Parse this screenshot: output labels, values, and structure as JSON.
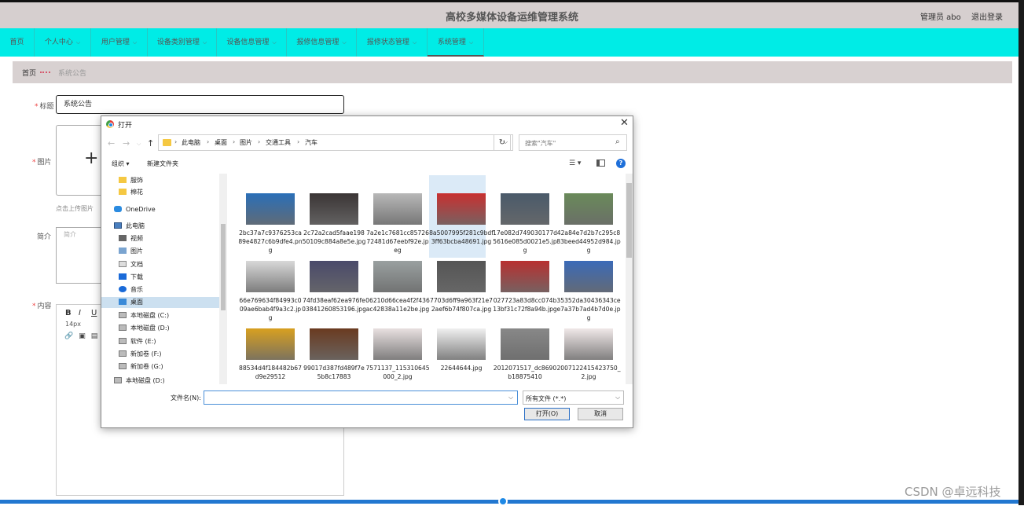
{
  "app": {
    "title": "高校多媒体设备运维管理系统",
    "admin_label": "管理员 abo",
    "logout": "退出登录"
  },
  "nav": [
    {
      "label": "首页",
      "dropdown": false
    },
    {
      "label": "个人中心",
      "dropdown": true
    },
    {
      "label": "用户管理",
      "dropdown": true
    },
    {
      "label": "设备类别管理",
      "dropdown": true
    },
    {
      "label": "设备信息管理",
      "dropdown": true
    },
    {
      "label": "报修信息管理",
      "dropdown": true
    },
    {
      "label": "报修状态管理",
      "dropdown": true
    },
    {
      "label": "系统管理",
      "dropdown": true,
      "active": true
    }
  ],
  "breadcrumb": {
    "home": "首页",
    "current": "系统公告"
  },
  "form": {
    "title_label": "标题",
    "title_value": "系统公告",
    "image_label": "图片",
    "upload_plus": "+",
    "upload_hint": "点击上传图片",
    "intro_label": "简介",
    "intro_placeholder": "简介",
    "content_label": "内容",
    "editor": {
      "bold": "B",
      "italic": "I",
      "underline": "U",
      "font_size": "14px"
    }
  },
  "dialog": {
    "title": "打开",
    "close": "✕",
    "path": [
      "此电脑",
      "桌面",
      "图片",
      "交通工具",
      "汽车"
    ],
    "search_placeholder": "搜索\"汽车\"",
    "organize": "组织 ▾",
    "new_folder": "新建文件夹",
    "sidebar": [
      {
        "label": "服饰",
        "icon": "folder",
        "indent": 1
      },
      {
        "label": "棉花",
        "icon": "folder",
        "indent": 1
      },
      {
        "label": "OneDrive",
        "icon": "cloud",
        "indent": 0
      },
      {
        "label": "此电脑",
        "icon": "pc",
        "indent": 0
      },
      {
        "label": "视频",
        "icon": "video",
        "indent": 1
      },
      {
        "label": "图片",
        "icon": "pic",
        "indent": 1
      },
      {
        "label": "文档",
        "icon": "doc",
        "indent": 1
      },
      {
        "label": "下载",
        "icon": "down",
        "indent": 1
      },
      {
        "label": "音乐",
        "icon": "music",
        "indent": 1
      },
      {
        "label": "桌面",
        "icon": "desk",
        "indent": 1,
        "selected": true
      },
      {
        "label": "本地磁盘 (C:)",
        "icon": "drive",
        "indent": 1
      },
      {
        "label": "本地磁盘 (D:)",
        "icon": "drive",
        "indent": 1
      },
      {
        "label": "软件 (E:)",
        "icon": "drive",
        "indent": 1
      },
      {
        "label": "新加卷 (F:)",
        "icon": "drive",
        "indent": 1
      },
      {
        "label": "新加卷 (G:)",
        "icon": "drive",
        "indent": 1
      },
      {
        "label": "本地磁盘 (D:)",
        "icon": "drive",
        "indent": 0
      }
    ],
    "files": [
      {
        "name": "2bc37a7c9376253ca89e4827c6b9dfe4.png",
        "color": "#2a6fb8"
      },
      {
        "name": "2c72a2cad5faae19850109c884a8e5e.jpg",
        "color": "#3a3535"
      },
      {
        "name": "7a2e1c7681cc8572672481d67eebf92e.jpeg",
        "color": "#b8b8b8"
      },
      {
        "name": "8a5007995f281c9bdf3ff63bcba48691.jpg",
        "color": "#c83030",
        "selected": true
      },
      {
        "name": "17e082d749030177d5616e085d0021e5.jpg",
        "color": "#4a5a6a"
      },
      {
        "name": "42a84e7d2b7c295c883beed44952d984.jpg",
        "color": "#6a8a5a"
      },
      {
        "name": "66e769634f84993c009ae6bab4f9a3c2.jpg",
        "color": "#d8d8d8"
      },
      {
        "name": "74fd38eaf62ea976fe03841260853196.jpg",
        "color": "#4a4a6a"
      },
      {
        "name": "06210d66cea4f2f436ac42838a11e2be.jpg",
        "color": "#9aa0a0"
      },
      {
        "name": "7703d6ff9a963f21e72aef6b74f807ca.jpg",
        "color": "#555"
      },
      {
        "name": "027723a83d8cc074b13bf31c72f8a94b.jpg",
        "color": "#b83030"
      },
      {
        "name": "35352da30436343cee7a37b7ad4b7d0e.jpg",
        "color": "#3a6ab8"
      },
      {
        "name": "88534d4f184482b67d9e29512",
        "color": "#d8a020"
      },
      {
        "name": "99017d387fd489f7e5b8c17883",
        "color": "#6a3a20"
      },
      {
        "name": "7571137_115310645000_2.jpg",
        "color": "#e8e0e0"
      },
      {
        "name": "22644644.jpg",
        "color": "#f0f0f0"
      },
      {
        "name": "2012071517_dc8690b18875410",
        "color": "#888"
      },
      {
        "name": "2007122415423750_2.jpg",
        "color": "#f0e8e8"
      }
    ],
    "filename_label": "文件名(N):",
    "filename_value": "",
    "filetype": "所有文件 (*.*)",
    "open_button": "打开(O)",
    "cancel_button": "取消"
  },
  "watermark": "CSDN @卓远科技"
}
